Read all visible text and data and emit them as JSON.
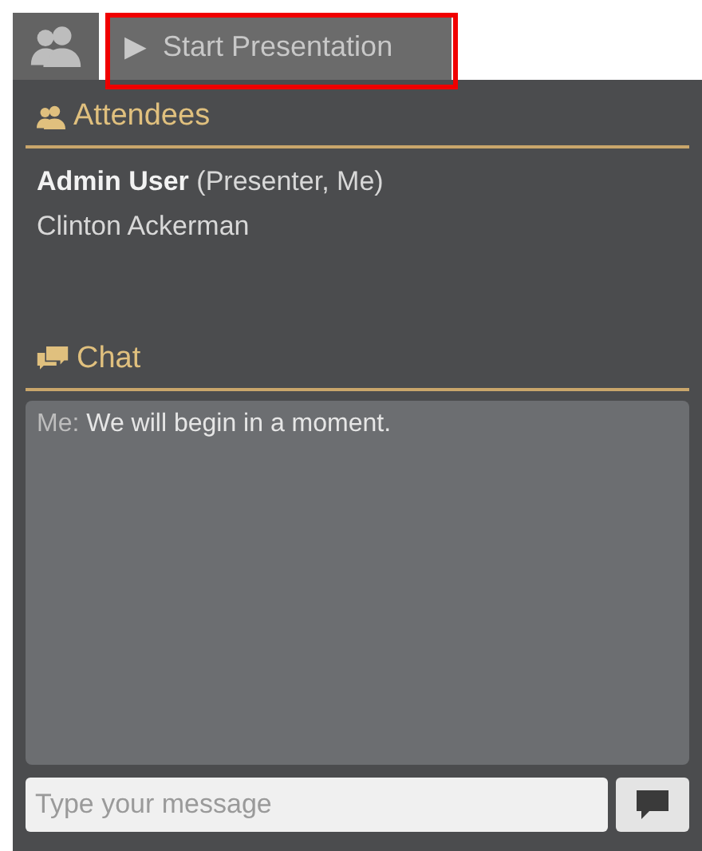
{
  "toolbar": {
    "presentation_button": {
      "icon": "▶",
      "label": "Start Presentation",
      "highlighted": true
    }
  },
  "attendees": {
    "title": "Attendees",
    "people": [
      {
        "name": "Admin User",
        "role": "(Presenter, Me)"
      },
      {
        "name": "Clinton Ackerman"
      }
    ]
  },
  "chat": {
    "title": "Chat",
    "messages": [
      {
        "sender": "Me:",
        "text": "We will begin in a moment."
      }
    ],
    "input": {
      "placeholder": "Type your message"
    }
  }
}
